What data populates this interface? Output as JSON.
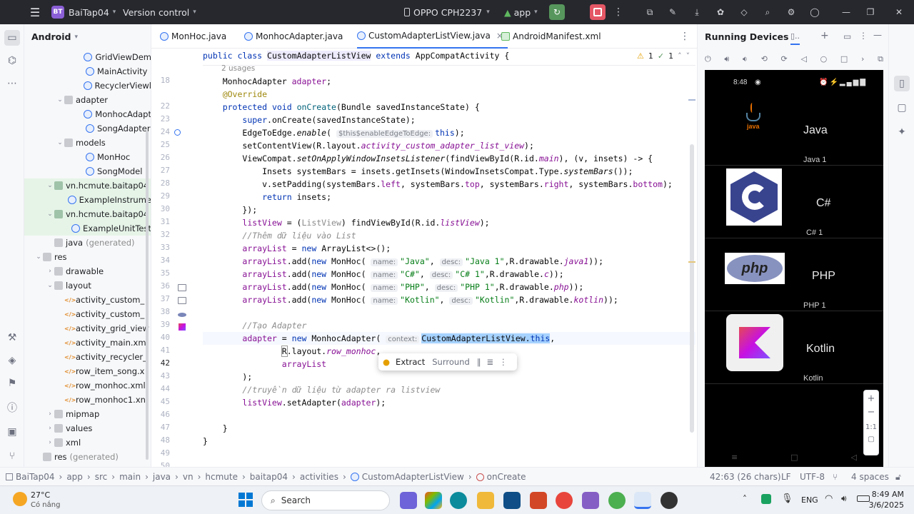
{
  "titlebar": {
    "project_badge": "BT",
    "project": "BaiTap04",
    "vcs": "Version control",
    "device": "OPPO CPH2237",
    "run_config": "app"
  },
  "project_panel": {
    "title": "Android",
    "items": [
      {
        "label": "GridViewDem",
        "kind": "class"
      },
      {
        "label": "MainActivity",
        "kind": "class"
      },
      {
        "label": "RecyclerViewl",
        "kind": "class"
      },
      {
        "label": "adapter",
        "kind": "package"
      },
      {
        "label": "MonhocAdapt",
        "kind": "class"
      },
      {
        "label": "SongAdapter",
        "kind": "class"
      },
      {
        "label": "models",
        "kind": "package"
      },
      {
        "label": "MonHoc",
        "kind": "class"
      },
      {
        "label": "SongModel",
        "kind": "class"
      },
      {
        "label": "vn.hcmute.baitap04",
        "kind": "testpkg"
      },
      {
        "label": "ExampleInstrume",
        "kind": "testclass"
      },
      {
        "label": "vn.hcmute.baitap04",
        "kind": "testpkg"
      },
      {
        "label": "ExampleUnitTest",
        "kind": "testclass"
      },
      {
        "label": "java",
        "suffix": "(generated)",
        "kind": "folder"
      },
      {
        "label": "res",
        "kind": "folder"
      },
      {
        "label": "drawable",
        "kind": "folder"
      },
      {
        "label": "layout",
        "kind": "folder"
      },
      {
        "label": "activity_custom_",
        "kind": "xml"
      },
      {
        "label": "activity_custom_",
        "kind": "xml"
      },
      {
        "label": "activity_grid_view",
        "kind": "xml"
      },
      {
        "label": "activity_main.xm",
        "kind": "xml"
      },
      {
        "label": "activity_recycler_",
        "kind": "xml"
      },
      {
        "label": "row_item_song.x",
        "kind": "xml"
      },
      {
        "label": "row_monhoc.xml",
        "kind": "xml"
      },
      {
        "label": "row_monhoc1.xn",
        "kind": "xml"
      },
      {
        "label": "mipmap",
        "kind": "folder"
      },
      {
        "label": "values",
        "kind": "folder"
      },
      {
        "label": "xml",
        "kind": "folder"
      },
      {
        "label": "res",
        "suffix": "(generated)",
        "kind": "folder"
      }
    ]
  },
  "editor": {
    "tabs": [
      {
        "label": "MonHoc.java"
      },
      {
        "label": "MonhocAdapter.java"
      },
      {
        "label": "CustomAdapterListView.java",
        "close": "×"
      },
      {
        "label": "AndroidManifest.xml"
      }
    ],
    "warnings": "1",
    "checks": "1",
    "usages": "2 usages",
    "line_numbers": [
      "18",
      "22",
      "23",
      "24",
      "25",
      "26",
      "27",
      "28",
      "29",
      "30",
      "31",
      "32",
      "33",
      "34",
      "35",
      "36",
      "37",
      "38",
      "39",
      "40",
      "41",
      "42",
      "43",
      "44",
      "45",
      "46",
      "47",
      "48",
      "49",
      "50"
    ],
    "hints": {
      "this_enable": "$this$enableEdgeToEdge:",
      "name": "name:",
      "desc": "desc:",
      "context": "context:"
    },
    "strings": {
      "java": "\"Java\"",
      "java1": "\"Java 1\"",
      "cs": "\"C#\"",
      "cs1": "\"C# 1\"",
      "php": "\"PHP\"",
      "php1": "\"PHP 1\"",
      "kotlin": "\"Kotlin\""
    },
    "comments": {
      "add": "//Thêm dữ liệu vào List",
      "create": "//Tạo Adapter",
      "pass": "//truyền dữ liệu từ adapter ra listview"
    },
    "popup": {
      "extract": "Extract",
      "surround": "Surround"
    }
  },
  "running_devices": {
    "title": "Running Devices",
    "phone_time": "8:48",
    "items": [
      {
        "name": "Java",
        "desc": "Java 1"
      },
      {
        "name": "C#",
        "desc": "C# 1"
      },
      {
        "name": "PHP",
        "desc": "PHP 1"
      },
      {
        "name": "Kotlin",
        "desc": "Kotlin"
      }
    ],
    "zoom": "1:1"
  },
  "statusbar": {
    "breadcrumbs": [
      "BaiTap04",
      "app",
      "src",
      "main",
      "java",
      "vn",
      "hcmute",
      "baitap04",
      "activities",
      "CustomAdapterListView",
      "onCreate"
    ],
    "position": "42:63 (26 chars)",
    "line_sep": "LF",
    "encoding": "UTF-8",
    "indent": "4 spaces"
  },
  "taskbar": {
    "temp": "27°C",
    "weather": "Có nắng",
    "search": "Search",
    "lang": "ENG",
    "time": "8:49 AM",
    "date": "3/6/2025"
  },
  "colors": {
    "accent": "#3574f0",
    "keyword": "#0033b3",
    "string": "#067d17",
    "field": "#871094"
  }
}
